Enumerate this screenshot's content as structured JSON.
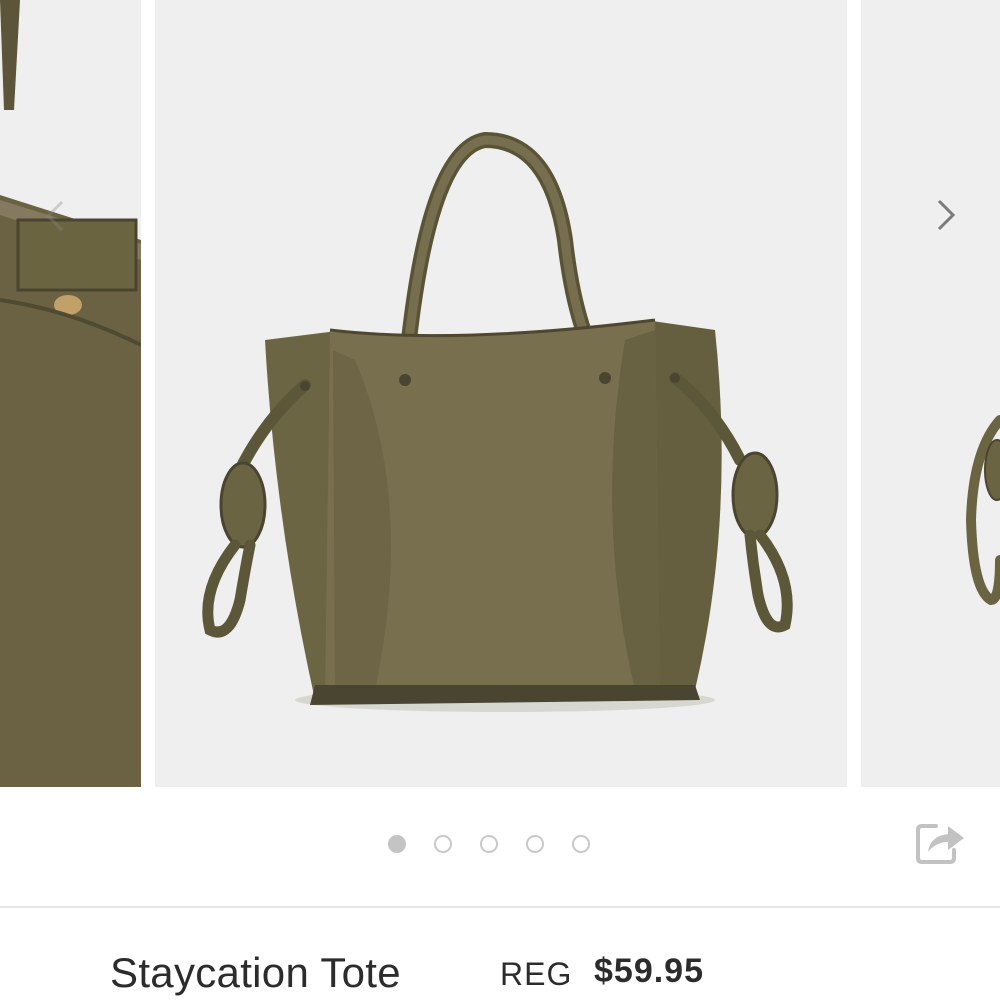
{
  "carousel": {
    "slide_count": 5,
    "active_index": 0,
    "prev_icon": "chevron-left-icon",
    "next_icon": "chevron-right-icon"
  },
  "share": {
    "icon": "share-icon"
  },
  "product": {
    "name": "Staycation Tote",
    "price_label": "REG",
    "price": "$59.95",
    "color_hex": "#6b6442"
  }
}
